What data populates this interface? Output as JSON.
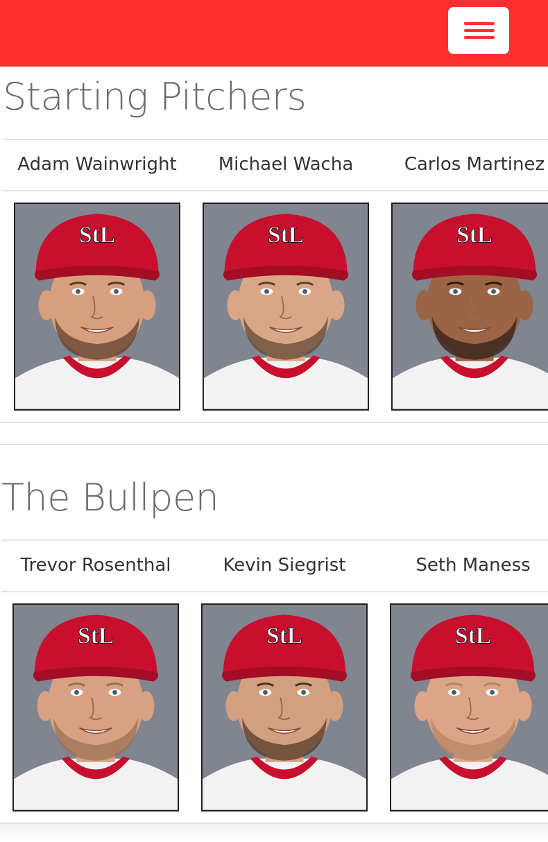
{
  "colors": {
    "accent": "#ff2f2f",
    "cap": "#c8102e",
    "jersey": "#f2f2f2",
    "photo_bg": "#808590"
  },
  "navbar": {
    "menu_icon": "hamburger-icon"
  },
  "sections": [
    {
      "title": "Starting Pitchers",
      "players": [
        {
          "name": "Adam Wainwright",
          "skin": "#d6a07f",
          "beard": "#5a3b2a"
        },
        {
          "name": "Michael Wacha",
          "skin": "#d9a786",
          "beard": "#5b4130"
        },
        {
          "name": "Carlos Martinez",
          "skin": "#9b6444",
          "beard": "#2b1a12"
        }
      ]
    },
    {
      "title": "The Bullpen",
      "players": [
        {
          "name": "Trevor Rosenthal",
          "skin": "#d8a181",
          "beard": "#9a6e52"
        },
        {
          "name": "Kevin Siegrist",
          "skin": "#d3a07f",
          "beard": "#4d3322"
        },
        {
          "name": "Seth Maness",
          "skin": "#dca585",
          "beard": "#b48563"
        }
      ]
    }
  ]
}
